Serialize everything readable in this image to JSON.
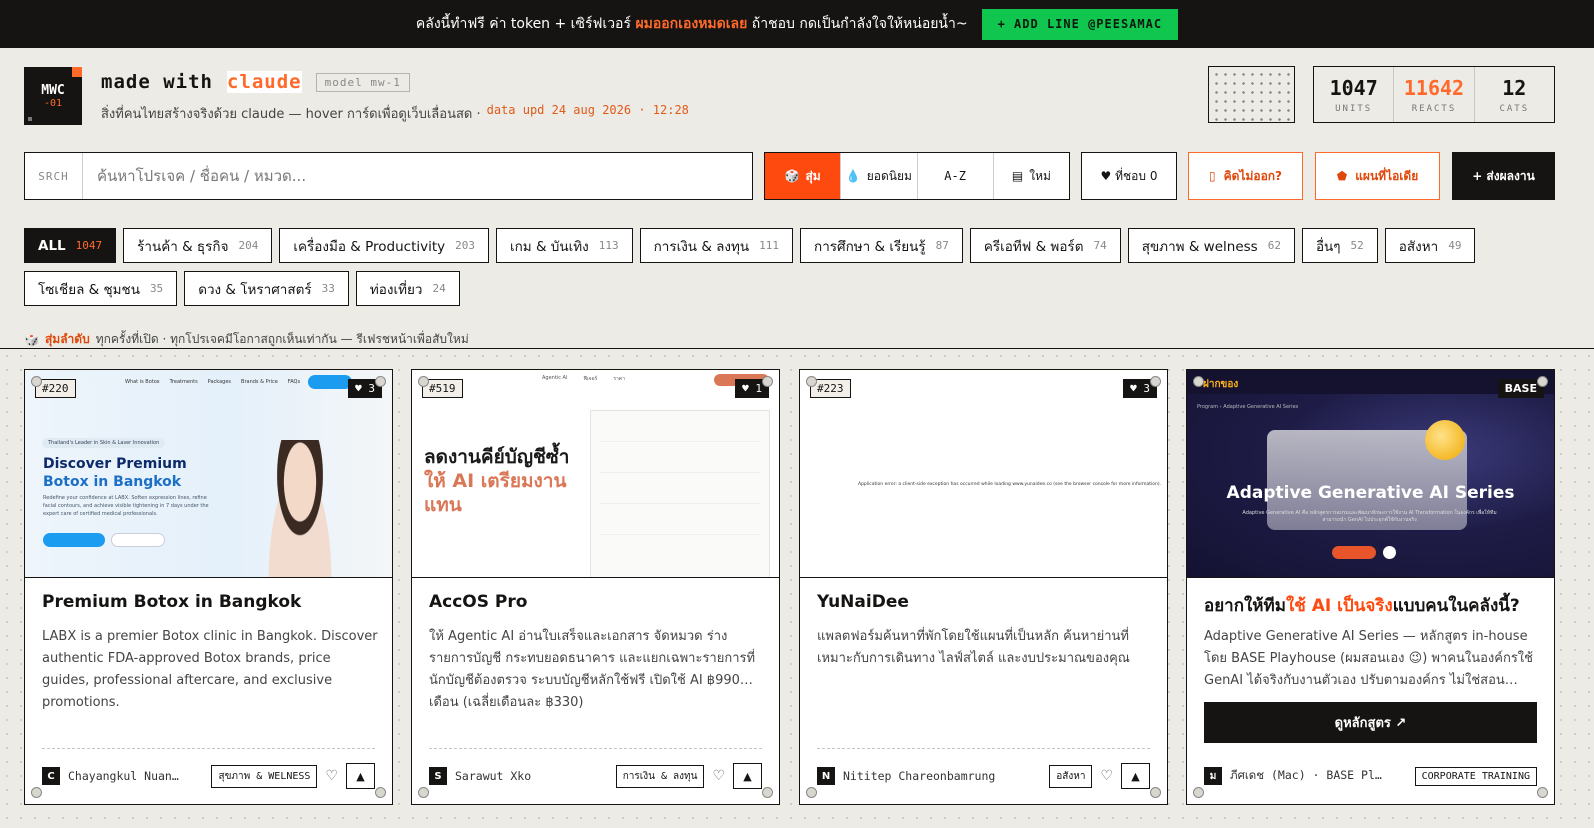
{
  "banner": {
    "text_before": "คลังนี้ทำฟรี ค่า token + เซิร์ฟเวอร์",
    "highlight": "ผมออกเองหมดเลย",
    "text_after": "ถ้าชอบ กดเป็นกำลังใจให้หน่อยน้ำ~",
    "line_button": "+ ADD LINE @PEESAMAC"
  },
  "logo": {
    "line1": "MWC",
    "line2": "-01"
  },
  "header": {
    "title_a": "made with",
    "title_b": "claude",
    "model": "model mw-1",
    "subtitle": "สิ่งที่คนไทยสร้างจริงด้วย claude — hover การ์ดเพื่อดูเว็บเลื่อนสด ·",
    "updated": "data upd 24 aug 2026 · 12:28"
  },
  "stats": [
    {
      "num": "1047",
      "label": "UNITS",
      "accent": false
    },
    {
      "num": "11642",
      "label": "REACTS",
      "accent": true
    },
    {
      "num": "12",
      "label": "CATS",
      "accent": false
    }
  ],
  "search": {
    "label": "SRCH",
    "placeholder": "ค้นหาโปรเจค / ชื่อคน / หมวด..."
  },
  "sort": [
    {
      "icon": "🎲",
      "label": "สุ่ม"
    },
    {
      "icon": "💧",
      "label": "ยอดนิยม"
    },
    {
      "icon": "",
      "label": "A-Z"
    },
    {
      "icon": "▤",
      "label": "ใหม่"
    }
  ],
  "buttons": {
    "favorites": "♥ ที่ชอบ 0",
    "no_idea": "คิดไม่ออก?",
    "idea_map": "แผนที่ไอเดีย",
    "submit": "+ ส่งผลงาน"
  },
  "categories": [
    {
      "label": "ALL",
      "count": "1047"
    },
    {
      "label": "ร้านค้า & ธุรกิจ",
      "count": "204"
    },
    {
      "label": "เครื่องมือ & Productivity",
      "count": "203"
    },
    {
      "label": "เกม & บันเทิง",
      "count": "113"
    },
    {
      "label": "การเงิน & ลงทุน",
      "count": "111"
    },
    {
      "label": "การศึกษา & เรียนรู้",
      "count": "87"
    },
    {
      "label": "ครีเอทีฟ & พอร์ต",
      "count": "74"
    },
    {
      "label": "สุขภาพ & welness",
      "count": "62"
    },
    {
      "label": "อื่นๆ",
      "count": "52"
    },
    {
      "label": "อสังหา",
      "count": "49"
    },
    {
      "label": "โซเชียล & ชุมชน",
      "count": "35"
    },
    {
      "label": "ดวง & โหราศาสตร์",
      "count": "33"
    },
    {
      "label": "ท่องเที่ยว",
      "count": "24"
    }
  ],
  "shuffle_note": {
    "key": "สุ่มลำดับ",
    "text": "ทุกครั้งที่เปิด · ทุกโปรเจคมีโอกาสถูกเห็นเท่ากัน — รีเฟรชหน้าเพื่อสับใหม่"
  },
  "cards": [
    {
      "id": "#220",
      "likes": "♥ 3",
      "title": "Premium Botox in Bangkok",
      "desc": "LABX is a premier Botox clinic in Bangkok. Discover authentic FDA-approved Botox brands, price guides, professional aftercare, and exclusive promotions.",
      "avatar": "C",
      "author": "Chayangkul Nuan…",
      "tag": "สุขภาพ & WELNESS",
      "thumb": {
        "nav": [
          "What is Botox",
          "Treatments",
          "Packages",
          "Brands & Price",
          "FAQs"
        ],
        "pill": "Thailand's Leader in Skin & Laser Innovation",
        "head1": "Discover Premium",
        "head2": "Botox in Bangkok",
        "small": "Redefine your confidence at LABX. Soften expression lines, refine facial contours, and achieve visible tightening in 7 days under the expert care of certified medical professionals."
      }
    },
    {
      "id": "#519",
      "likes": "♥ 1",
      "title": "AccOS Pro",
      "desc": "ให้ Agentic AI อ่านใบเสร็จและเอกสาร จัดหมวด ร่างรายการบัญชี กระทบยอดธนาคาร และแยกเฉพาะรายการที่นักบัญชีต้องตรวจ ระบบบัญชีหลักใช้ฟรี เปิดใช้ AI ฿990… เดือน (เฉลี่ยเดือนละ ฿330)",
      "avatar": "S",
      "author": "Sarawut Xko",
      "tag": "การเงิน & ลงทุน",
      "thumb": {
        "nav": [
          "Agentic AI",
          "ฟีเจอร์",
          "ราคา"
        ],
        "head1": "ลดงานคีย์บัญชีซ้ำ",
        "head2": "ให้ AI เตรียมงาน",
        "head3": "แทน"
      }
    },
    {
      "id": "#223",
      "likes": "♥ 3",
      "title": "YuNaiDee",
      "desc": "แพลตฟอร์มค้นหาที่พักโดยใช้แผนที่เป็นหลัก ค้นหาย่านที่เหมาะกับการเดินทาง ไลฟ์สไตล์ และงบประมาณของคุณ",
      "avatar": "N",
      "author": "Nititep Chareonbamrung",
      "tag": "อสังหา",
      "thumb": {
        "error": "Application error: a client-side exception has occurred while loading www.yunaidee.co (see the browser console for more information)."
      }
    },
    {
      "id": "ฝากของ",
      "likes": "BASE",
      "title_a": "อยากให้ทีม",
      "title_b": "ใช้ AI เป็นจริง",
      "title_c": "แบบคนในคลังนี้?",
      "desc": "Adaptive Generative AI Series — หลักสูตร in-house โดย BASE Playhouse (ผมสอนเอง 😉) พาคนในองค์กรใช้ GenAI ได้จริงกับงานตัวเอง ปรับตามองค์กร ไม่ใช่สอน…",
      "cta": "ดูหลักสูตร ↗",
      "avatar": "ม",
      "author": "ภีศเดช (Mac) · BASE Pl…",
      "tag": "CORPORATE TRAINING",
      "thumb": {
        "crumb": "Program  ›  Adaptive Generative AI Series",
        "big": "Adaptive Generative AI Series",
        "small": "Adaptive Generative AI คือ หลักสูตรการอบรมและพัฒนาทักษะการใช้งาน AI Transformation ในองค์กร เพื่อให้ทีมสามารถนำ GenAI ไปประยุกต์ใช้กับงานจริง"
      }
    }
  ]
}
